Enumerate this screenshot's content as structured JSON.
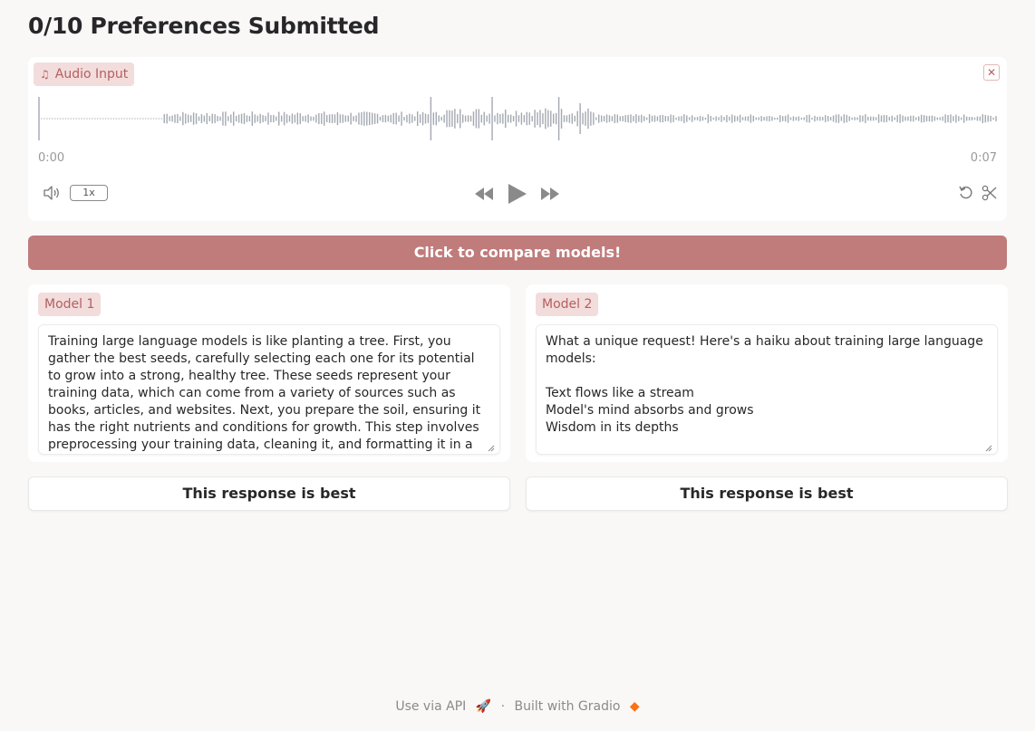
{
  "header": {
    "title": "0/10 Preferences Submitted"
  },
  "audio": {
    "label": "Audio Input",
    "label_icon": "music-note-icon",
    "clear_icon": "close-icon",
    "time_start": "0:00",
    "time_end": "0:07",
    "speed": "1x",
    "icons": [
      "volume-icon",
      "rewind-icon",
      "play-icon",
      "fast-forward-icon",
      "undo-icon",
      "scissors-icon"
    ]
  },
  "compare_button": {
    "label": "Click to compare models!"
  },
  "models": [
    {
      "label": "Model 1",
      "response": "Training large language models is like planting a tree. First, you gather the best seeds, carefully selecting each one for its potential to grow into a strong, healthy tree. These seeds represent your training data, which can come from a variety of sources such as books, articles, and websites. Next, you prepare the soil, ensuring it has the right nutrients and conditions for growth. This step involves preprocessing your training data, cleaning it, and formatting it in a way that the model can"
    },
    {
      "label": "Model 2",
      "response": "What a unique request! Here's a haiku about training large language models:\n\nText flows like a stream\nModel's mind absorbs and grows\nWisdom in its depths"
    }
  ],
  "vote_buttons": [
    {
      "label": "This response is best"
    },
    {
      "label": "This response is best"
    }
  ],
  "footer": {
    "api_link": "Use via API",
    "separator": "·",
    "built_with": "Built with Gradio"
  },
  "colors": {
    "accent": "#c07b7b",
    "chip_bg": "#f3dcdc",
    "chip_text": "#b45f5f",
    "background": "#f9f8f7"
  }
}
